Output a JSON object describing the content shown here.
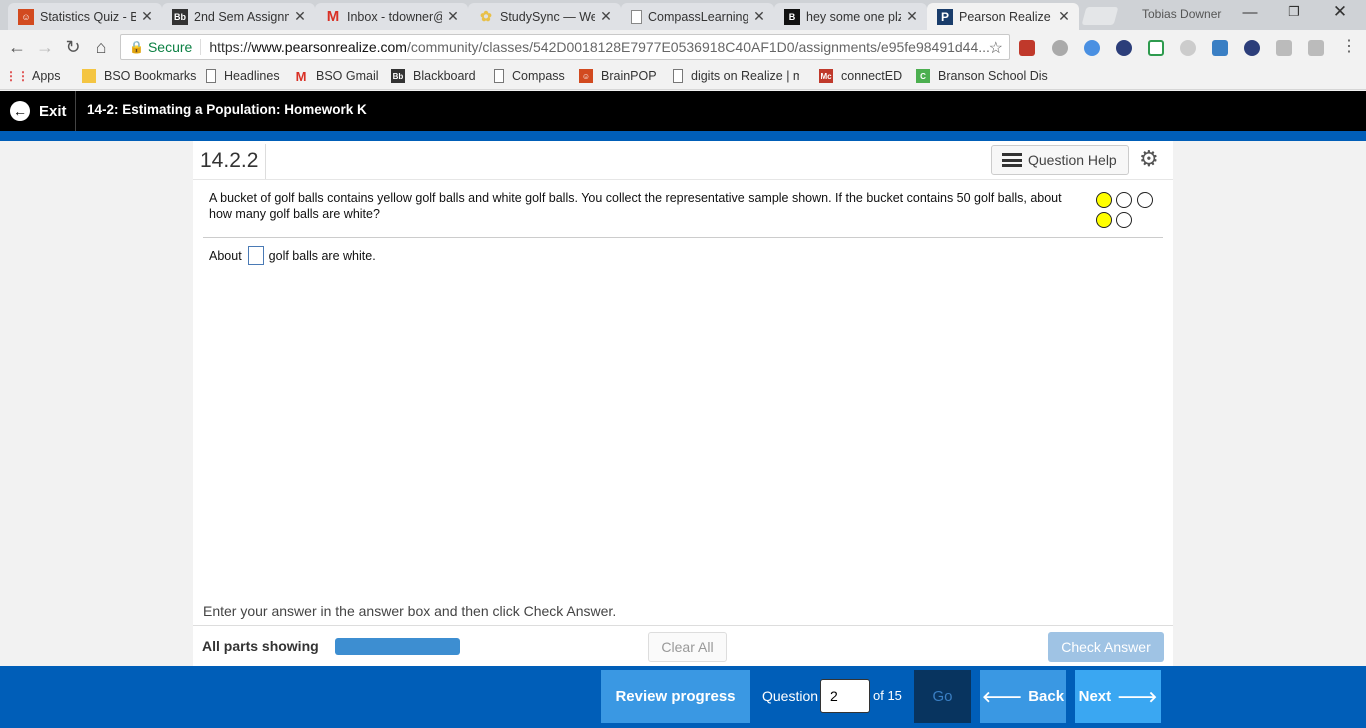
{
  "browser": {
    "tabs": [
      {
        "title": "Statistics Quiz - B",
        "icon": "brainpop-icon",
        "color": "#d24a1f"
      },
      {
        "title": "2nd Sem Assignm",
        "icon": "blackboard-icon",
        "color": "#333333"
      },
      {
        "title": "Inbox - tdowner@",
        "icon": "gmail-icon",
        "color": "#d93025"
      },
      {
        "title": "StudySync — We",
        "icon": "studysync-icon",
        "color": "#e8c04a"
      },
      {
        "title": "CompassLearning",
        "icon": "page-icon",
        "color": "#888888"
      },
      {
        "title": "hey some one plz",
        "icon": "brainly-icon",
        "color": "#111111"
      },
      {
        "title": "Pearson Realize",
        "icon": "pearson-icon",
        "color": "#1a3d6b"
      }
    ],
    "user_name": "Tobias Downer",
    "secure_label": "Secure",
    "url_scheme": "https://",
    "url_host": "www.pearsonrealize.com",
    "url_path": "/community/classes/542D0018128E7977E0536918C40AF1D0/assignments/e95fe98491d44...",
    "bookmarks": [
      {
        "label": "Apps",
        "icon": "apps-grid-icon"
      },
      {
        "label": "BSO Bookmarks",
        "icon": "folder-icon"
      },
      {
        "label": "Headlines",
        "icon": "page-icon"
      },
      {
        "label": "BSO Gmail",
        "icon": "gmail-icon"
      },
      {
        "label": "Blackboard",
        "icon": "blackboard-icon"
      },
      {
        "label": "Compass",
        "icon": "page-icon"
      },
      {
        "label": "BrainPOP",
        "icon": "brainpop-icon"
      },
      {
        "label": "digits on Realize | m",
        "icon": "page-icon"
      },
      {
        "label": "connectED",
        "icon": "connected-icon"
      },
      {
        "label": "Branson School Distr",
        "icon": "branson-icon"
      }
    ]
  },
  "header": {
    "exit_label": "Exit",
    "assignment_title": "14-2: Estimating a Population: Homework K"
  },
  "question": {
    "number": "14.2.2",
    "help_label": "Question Help",
    "text": "A bucket of golf balls contains yellow golf balls and white golf balls. You collect the representative sample shown. If the bucket contains 50 golf balls, about how many golf balls are white?",
    "sample": {
      "row1": [
        "yellow",
        "white",
        "white"
      ],
      "row2": [
        "yellow",
        "white"
      ],
      "colors": {
        "yellow": "#ffff00",
        "white": "#ffffff"
      }
    },
    "answer_prefix": "About",
    "answer_value": "",
    "answer_suffix": "golf balls are white.",
    "instruction": "Enter your answer in the answer box and then click Check Answer.",
    "parts_label": "All parts showing",
    "parts_progress": 1.0,
    "clear_all_label": "Clear All",
    "check_answer_label": "Check Answer"
  },
  "footer": {
    "review_label": "Review progress",
    "question_label": "Question",
    "question_value": "2",
    "of_label": "of 15",
    "go_label": "Go",
    "back_label": "Back",
    "next_label": "Next"
  }
}
